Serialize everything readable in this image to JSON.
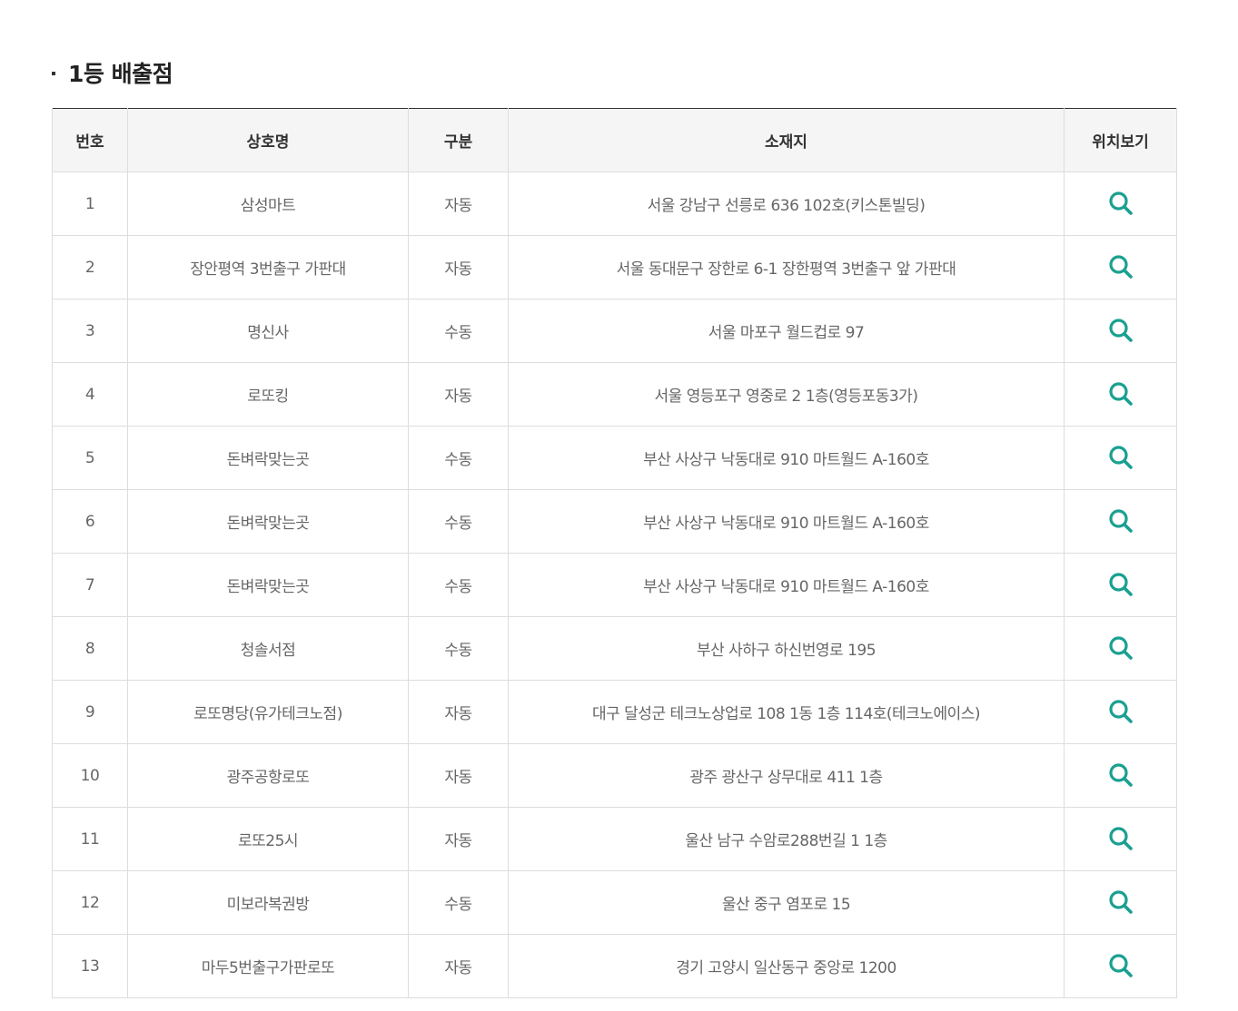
{
  "section": {
    "title": "1등 배출점"
  },
  "table": {
    "headers": [
      "번호",
      "상호명",
      "구분",
      "소재지",
      "위치보기"
    ],
    "rows": [
      {
        "no": "1",
        "name": "삼성마트",
        "type": "자동",
        "address": "서울 강남구 선릉로 636 102호(키스톤빌딩)"
      },
      {
        "no": "2",
        "name": "장안평역 3번출구 가판대",
        "type": "자동",
        "address": "서울 동대문구 장한로 6-1 장한평역 3번출구 앞 가판대"
      },
      {
        "no": "3",
        "name": "명신사",
        "type": "수동",
        "address": "서울 마포구 월드컵로 97"
      },
      {
        "no": "4",
        "name": "로또킹",
        "type": "자동",
        "address": "서울 영등포구 영중로 2 1층(영등포동3가)"
      },
      {
        "no": "5",
        "name": "돈벼락맞는곳",
        "type": "수동",
        "address": "부산 사상구 낙동대로 910 마트월드 A-160호"
      },
      {
        "no": "6",
        "name": "돈벼락맞는곳",
        "type": "수동",
        "address": "부산 사상구 낙동대로 910 마트월드 A-160호"
      },
      {
        "no": "7",
        "name": "돈벼락맞는곳",
        "type": "수동",
        "address": "부산 사상구 낙동대로 910 마트월드 A-160호"
      },
      {
        "no": "8",
        "name": "청솔서점",
        "type": "수동",
        "address": "부산 사하구 하신번영로 195"
      },
      {
        "no": "9",
        "name": "로또명당(유가테크노점)",
        "type": "자동",
        "address": "대구 달성군 테크노상업로 108 1동 1층 114호(테크노에이스)"
      },
      {
        "no": "10",
        "name": "광주공항로또",
        "type": "자동",
        "address": "광주 광산구 상무대로 411 1층"
      },
      {
        "no": "11",
        "name": "로또25시",
        "type": "자동",
        "address": "울산 남구 수암로288번길 1 1층"
      },
      {
        "no": "12",
        "name": "미보라복권방",
        "type": "수동",
        "address": "울산 중구 염포로 15"
      },
      {
        "no": "13",
        "name": "마두5번출구가판로또",
        "type": "자동",
        "address": "경기 고양시 일산동구 중앙로 1200"
      }
    ]
  },
  "icons": {
    "locate": "search-icon"
  },
  "colors": {
    "accent": "#1aa091",
    "header_bg": "#f5f5f5",
    "border": "#dddddd",
    "title": "#222222"
  }
}
